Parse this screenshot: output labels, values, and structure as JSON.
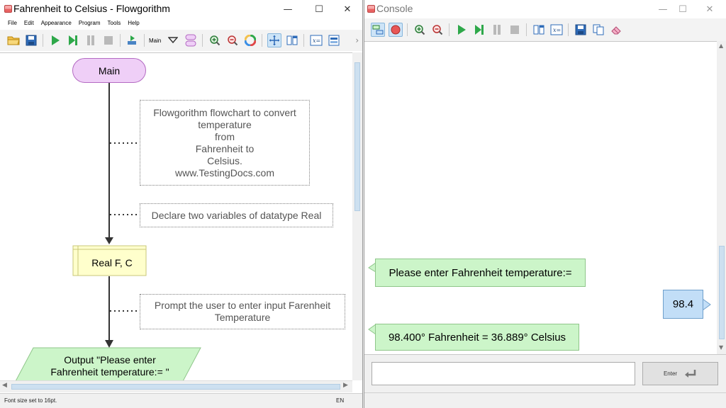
{
  "main_window": {
    "title": "Fahrenheit to Celsius - Flowgorithm",
    "controls": {
      "minimize": "—",
      "maximize": "☐",
      "close": "✕"
    },
    "menu": [
      "File",
      "Edit",
      "Appearance",
      "Program",
      "Tools",
      "Help"
    ],
    "toolbar": {
      "function_select": "Main",
      "icons": [
        "open-folder-icon",
        "save-icon",
        "run-icon",
        "step-icon",
        "pause-icon",
        "stop-icon",
        "run-speed-icon",
        "chevron-down-icon",
        "manage-functions-icon",
        "zoom-in-icon",
        "zoom-out-icon",
        "color-scheme-icon",
        "layout-icon",
        "split-view-icon",
        "variable-watch-icon",
        "source-code-icon"
      ]
    },
    "flowchart": {
      "start_label": "Main",
      "comment_1": "Flowgorithm flowchart to convert\ntemperature\nfrom\nFahrenheit to\nCelsius.\nwww.TestingDocs.com",
      "comment_2": "Declare two variables of datatype Real",
      "declare_label": "Real F, C",
      "comment_3": "Prompt the user to enter input Farenheit\nTemperature",
      "output_label": "Output \"Please enter\nFahrenheit temperature:= \""
    },
    "status": {
      "message": "Font size set to 16pt.",
      "language": "EN"
    },
    "colors": {
      "terminal": "#efcff7",
      "declare": "#ffffcc",
      "output": "#ccf5c9"
    }
  },
  "console_window": {
    "title": "Console",
    "controls": {
      "minimize": "—",
      "maximize": "☐",
      "close": "✕"
    },
    "toolbar_icons": [
      "chat-view-icon",
      "record-icon",
      "zoom-in-icon",
      "zoom-out-icon",
      "run-icon",
      "step-icon",
      "pause-icon",
      "stop-icon",
      "split-view-icon",
      "variable-watch-icon",
      "save-icon",
      "copy-icon",
      "eraser-icon"
    ],
    "messages": [
      {
        "type": "output",
        "text": "Please enter Fahrenheit temperature:="
      },
      {
        "type": "input",
        "text": "98.4"
      },
      {
        "type": "output",
        "text": "98.400° Fahrenheit = 36.889° Celsius"
      }
    ],
    "input_value": "",
    "enter_label": "Enter"
  }
}
